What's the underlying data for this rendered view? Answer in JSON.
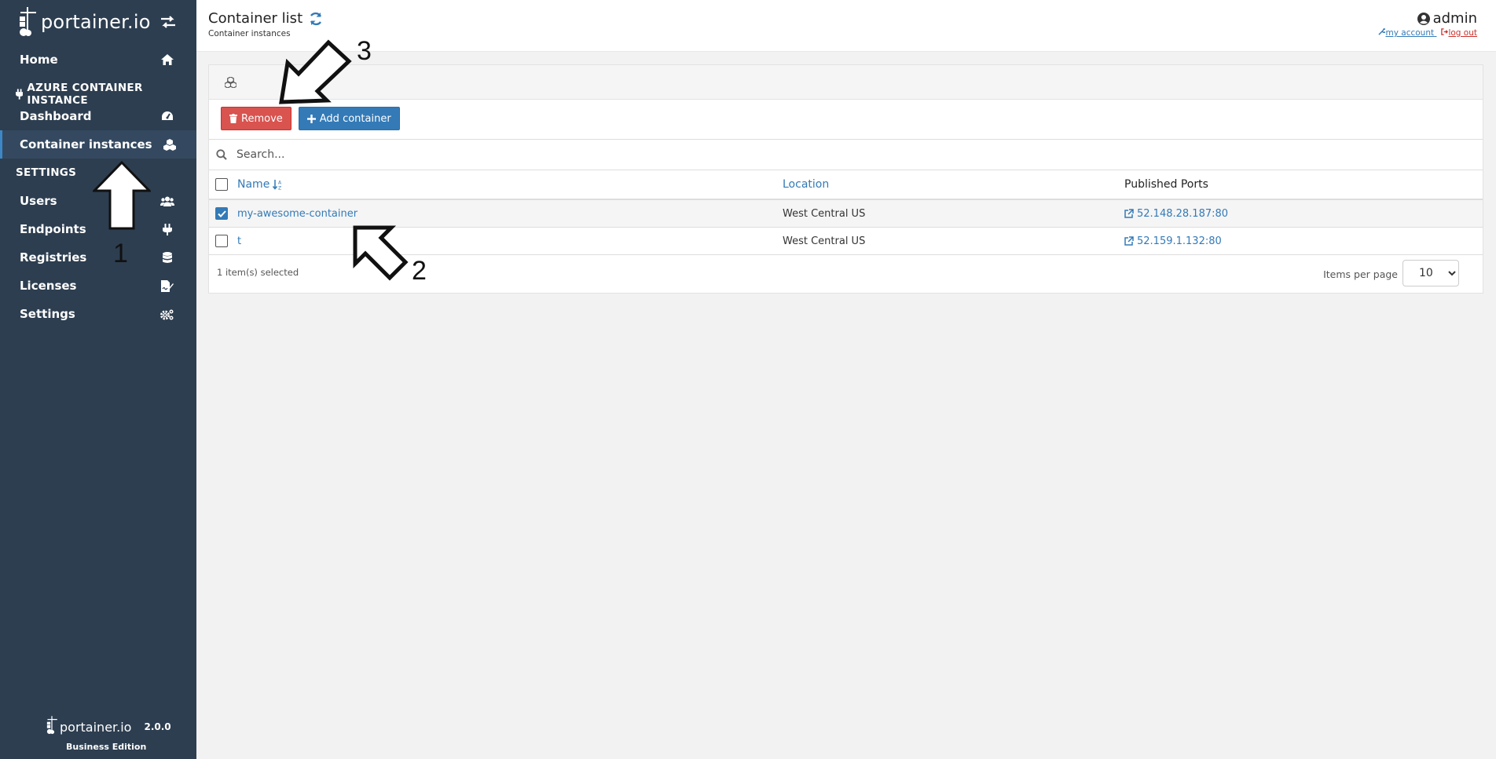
{
  "app": {
    "brand": "portainer.io",
    "version": "2.0.0",
    "edition": "Business Edition"
  },
  "sidebar": {
    "items": [
      {
        "label": "Home",
        "icon": "home-icon"
      },
      {
        "label": "Dashboard",
        "icon": "dashboard-icon"
      },
      {
        "label": "Container instances",
        "icon": "cubes-icon",
        "active": true
      },
      {
        "label": "Users",
        "icon": "users-icon"
      },
      {
        "label": "Endpoints",
        "icon": "plug-icon"
      },
      {
        "label": "Registries",
        "icon": "database-icon"
      },
      {
        "label": "Licenses",
        "icon": "file-signature-icon"
      },
      {
        "label": "Settings",
        "icon": "cogs-icon"
      }
    ],
    "sections": {
      "azure": "AZURE CONTAINER INSTANCE",
      "settings": "SETTINGS"
    }
  },
  "header": {
    "title": "Container list",
    "breadcrumb": "Container instances",
    "user": "admin",
    "my_account": "my account",
    "log_out": "log out"
  },
  "toolbar": {
    "remove_label": "Remove",
    "add_label": "Add container"
  },
  "search": {
    "placeholder": "Search..."
  },
  "table": {
    "columns": [
      "Name",
      "Location",
      "Published Ports"
    ],
    "rows": [
      {
        "name": "my-awesome-container",
        "location": "West Central US",
        "ports": "52.148.28.187:80",
        "selected": true
      },
      {
        "name": "t",
        "location": "West Central US",
        "ports": "52.159.1.132:80",
        "selected": false
      }
    ]
  },
  "footer": {
    "selected_text": "1 item(s) selected",
    "per_page_label": "Items per page",
    "per_page_value": "10"
  },
  "annotations": [
    "1",
    "2",
    "3"
  ],
  "colors": {
    "sidebar_bg": "#2d3e50",
    "primary": "#337ab7",
    "danger": "#d9534f"
  }
}
